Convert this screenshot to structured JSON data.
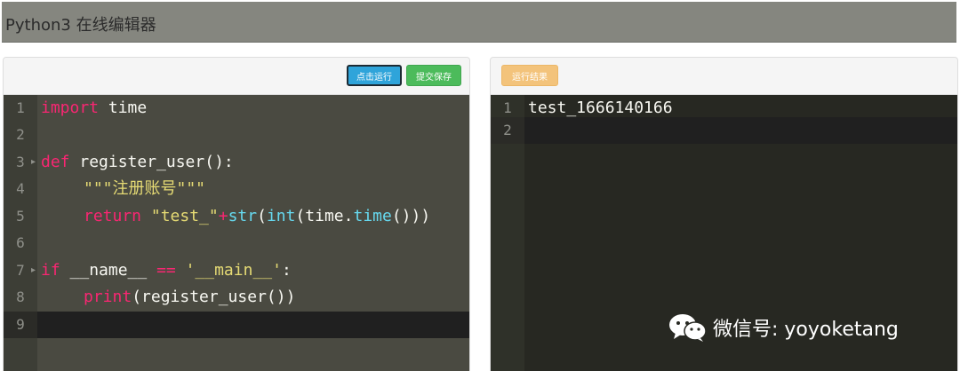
{
  "header": {
    "title": "Python3 在线编辑器"
  },
  "left_panel": {
    "run_button": "点击运行",
    "save_button": "提交保存",
    "lines": [
      {
        "num": "1"
      },
      {
        "num": "2"
      },
      {
        "num": "3"
      },
      {
        "num": "4"
      },
      {
        "num": "5"
      },
      {
        "num": "6"
      },
      {
        "num": "7"
      },
      {
        "num": "8"
      },
      {
        "num": "9"
      }
    ],
    "code": {
      "l1_kw": "import",
      "l1_rest": " time",
      "l3_kw": "def",
      "l3_rest": " register_user():",
      "l4_str": "\"\"\"注册账号\"\"\"",
      "l5_kw": "return",
      "l5_str": "\"test_\"",
      "l5_op": "+",
      "l5_fn1": "str",
      "l5_p1": "(",
      "l5_fn2": "int",
      "l5_p2": "(time.",
      "l5_fn3": "time",
      "l5_p3": "()))",
      "l7_kw": "if",
      "l7_name": " __name__ ",
      "l7_op": "==",
      "l7_str": " '__main__'",
      "l7_colon": ":",
      "l8_fn": "print",
      "l8_rest": "(register_user())"
    }
  },
  "right_panel": {
    "result_button": "运行结果",
    "lines": [
      {
        "num": "1",
        "text": "test_1666140166"
      },
      {
        "num": "2",
        "text": ""
      }
    ]
  },
  "watermark": {
    "text": "微信号: yoyoketang",
    "icon": "wechat-icon"
  }
}
